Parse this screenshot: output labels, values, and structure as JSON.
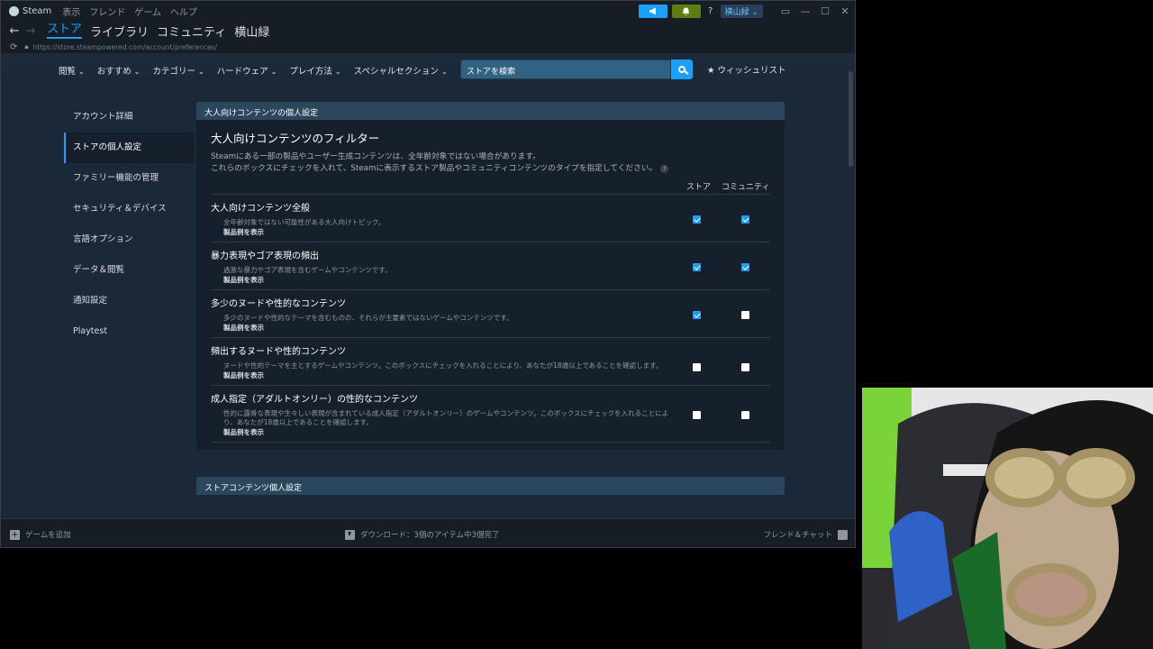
{
  "titlebar": {
    "app_name": "Steam",
    "menus": [
      "表示",
      "フレンド",
      "ゲーム",
      "ヘルプ"
    ],
    "help_label": "?",
    "username": "横山緑 ⌄",
    "window_minimize": "—",
    "window_maximize": "☐",
    "window_close": "✕",
    "announce_icon": "megaphone-icon",
    "bell_icon": "bell-icon"
  },
  "nav": {
    "back": "←",
    "forward": "→",
    "tabs": [
      "ストア",
      "ライブラリ",
      "コミュニティ",
      "横山緑"
    ],
    "active_tab": "ストア",
    "url": "https://store.steampowered.com/account/preferences/"
  },
  "store_header": {
    "menus": [
      "閲覧",
      "おすすめ",
      "カテゴリー",
      "ハードウェア",
      "プレイ方法",
      "スペシャルセクション"
    ],
    "search_placeholder": "ストアを検索",
    "wishlist": "ウィッシュリスト"
  },
  "sidebar": {
    "items": [
      {
        "label": "アカウント詳細"
      },
      {
        "label": "ストアの個人設定"
      },
      {
        "label": "ファミリー機能の管理"
      },
      {
        "label": "セキュリティ＆デバイス"
      },
      {
        "label": "言語オプション"
      },
      {
        "label": "データ＆閲覧"
      },
      {
        "label": "通知設定"
      },
      {
        "label": "Playtest"
      }
    ],
    "active_index": 1
  },
  "content": {
    "section1_header": "大人向けコンテンツの個人設定",
    "filter_title": "大人向けコンテンツのフィルター",
    "filter_desc1": "Steamにある一部の製品やユーザー生成コンテンツは、全年齢対象ではない場合があります。",
    "filter_desc2": "これらのボックスにチェックを入れて、Steamに表示するストア製品やコミュニティコンテンツのタイプを指定してください。",
    "help_glyph": "?",
    "col_store": "ストア",
    "col_community": "コミュニティ",
    "categories": [
      {
        "title": "大人向けコンテンツ全般",
        "desc": "全年齢対象ではない可能性がある大人向けトピック。",
        "link": "製品例を表示",
        "store_checked": true,
        "community_checked": true
      },
      {
        "title": "暴力表現やゴア表現の頻出",
        "desc": "過激な暴力やゴア表現を含むゲームやコンテンツです。",
        "link": "製品例を表示",
        "store_checked": true,
        "community_checked": true
      },
      {
        "title": "多少のヌードや性的なコンテンツ",
        "desc": "多少のヌードや性的なテーマを含むものの、それらが主要素ではないゲームやコンテンツです。",
        "link": "製品例を表示",
        "store_checked": true,
        "community_checked": false
      },
      {
        "title": "頻出するヌードや性的コンテンツ",
        "desc": "ヌードや性的テーマを主とするゲームやコンテンツ。このボックスにチェックを入れることにより、あなたが18歳以上であることを確認します。",
        "link": "製品例を表示",
        "store_checked": false,
        "community_checked": false
      },
      {
        "title": "成人指定（アダルトオンリー）の性的なコンテンツ",
        "desc": "性的に露骨な表現や生々しい表現が含まれている成人指定（アダルトオンリー）のゲームやコンテンツ。このボックスにチェックを入れることにより、あなたが18歳以上であることを確認します。",
        "link": "製品例を表示",
        "store_checked": false,
        "community_checked": false
      }
    ],
    "section2_header": "ストアコンテンツ個人設定"
  },
  "bottombar": {
    "add_game": "ゲームを追加",
    "downloads": "ダウンロード：3個のアイテム中3個完了",
    "friends_chat": "フレンド＆チャット"
  },
  "colors": {
    "accent": "#1a9fff",
    "bell_green": "#5c7e10",
    "bg": "#1b2838",
    "section_head": "#2a475e"
  }
}
